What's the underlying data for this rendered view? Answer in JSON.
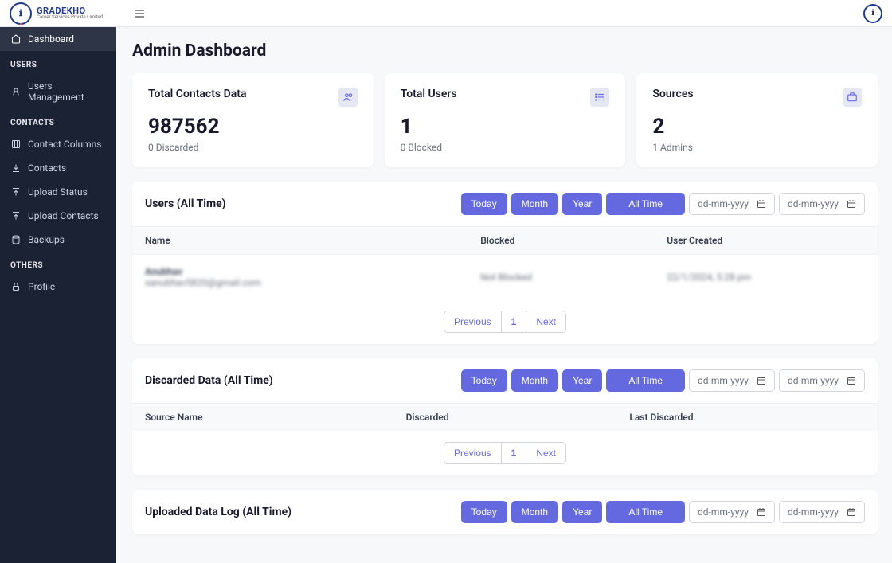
{
  "brand": {
    "title": "GRADEKHO",
    "sub": "Career Services Private Limited"
  },
  "sidebar": {
    "dashboard": "Dashboard",
    "sections": {
      "users": "USERS",
      "contacts": "CONTACTS",
      "others": "OTHERS"
    },
    "items": {
      "users_mgmt": "Users Management",
      "contact_columns": "Contact Columns",
      "contacts": "Contacts",
      "upload_status": "Upload Status",
      "upload_contacts": "Upload Contacts",
      "backups": "Backups",
      "profile": "Profile"
    }
  },
  "page": {
    "title": "Admin Dashboard"
  },
  "cards": {
    "contacts": {
      "label": "Total Contacts Data",
      "value": "987562",
      "sub": "0 Discarded"
    },
    "users": {
      "label": "Total Users",
      "value": "1",
      "sub": "0 Blocked"
    },
    "sources": {
      "label": "Sources",
      "value": "2",
      "sub": "1 Admins"
    }
  },
  "filters": {
    "today": "Today",
    "month": "Month",
    "year": "Year",
    "alltime": "All Time",
    "date_placeholder": "dd-mm-yyyy"
  },
  "panels": {
    "users": {
      "title": "Users (All Time)",
      "columns": {
        "name": "Name",
        "blocked": "Blocked",
        "created": "User Created"
      },
      "rows": [
        {
          "name": "Anubhav",
          "email": "sanubhav5820@gmail.com",
          "blocked": "Not Blocked",
          "created": "22/1/2024, 5:28 pm"
        }
      ]
    },
    "discarded": {
      "title": "Discarded Data (All Time)",
      "columns": {
        "source": "Source Name",
        "discarded": "Discarded",
        "last": "Last Discarded"
      }
    },
    "uploaded": {
      "title": "Uploaded Data Log (All Time)"
    }
  },
  "pagination": {
    "prev": "Previous",
    "page": "1",
    "next": "Next"
  }
}
